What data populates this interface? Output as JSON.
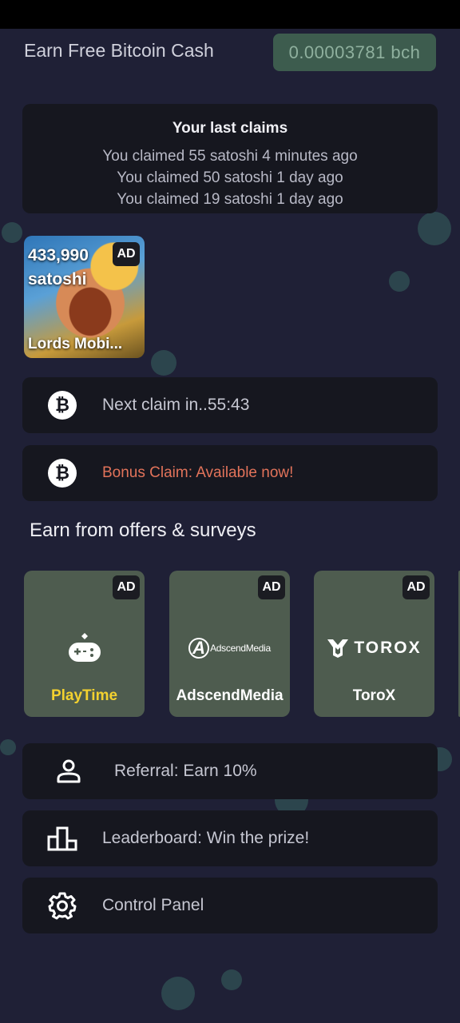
{
  "header": {
    "title": "Earn Free Bitcoin Cash",
    "balance": "0.00003781 bch"
  },
  "claims": {
    "title": "Your last claims",
    "items": [
      "You claimed 55 satoshi 4 minutes ago",
      "You claimed 50 satoshi 1 day ago",
      "You claimed 19 satoshi 1 day ago"
    ]
  },
  "ad_tile": {
    "points": "433,990",
    "unit": "satoshi",
    "badge": "AD",
    "name": "Lords Mobi..."
  },
  "next_claim": {
    "label": "Next claim in..55:43",
    "icon": "bitcoin-icon"
  },
  "bonus_claim": {
    "label": "Bonus Claim: Available now!",
    "icon": "bitcoin-icon",
    "color": "#e2735a"
  },
  "offers": {
    "title": "Earn from offers & surveys",
    "items": [
      {
        "name": "PlayTime",
        "badge": "AD",
        "icon": "gamepad-icon"
      },
      {
        "name": "AdscendMedia",
        "badge": "AD",
        "logo_text": "AdscendMedia",
        "icon": "adscend-logo"
      },
      {
        "name": "ToroX",
        "badge": "AD",
        "logo_text": "TOROX",
        "icon": "torox-logo"
      }
    ]
  },
  "menu": {
    "referral": {
      "label": "Referral: Earn 10%",
      "icon": "person-icon"
    },
    "leaderboard": {
      "label": "Leaderboard: Win the prize!",
      "icon": "podium-icon"
    },
    "control_panel": {
      "label": "Control Panel",
      "icon": "gear-icon"
    }
  },
  "colors": {
    "background": "#1f2036",
    "card": "#16171f",
    "balance_pill": "#3d5c4e",
    "offer_card": "#4e5c4f",
    "playtime_label": "#f3d12f"
  }
}
